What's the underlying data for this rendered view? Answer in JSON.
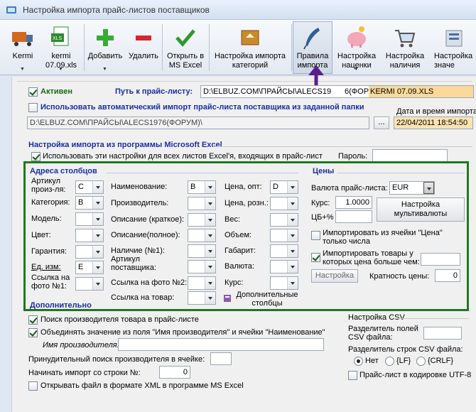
{
  "window": {
    "title": "Настройка импорта прайс-листов поставщиков"
  },
  "toolbar": {
    "kermi": "Kermi",
    "kermi_xls": "kermi\n07.09.xls",
    "add": "Добавить",
    "delete": "Удалить",
    "open_excel": "Открыть в\nMS Excel",
    "category_import": "Настройка импорта\nкатегорий",
    "import_rules": "Правила\nимпорта",
    "markup": "Настройка\nнаценки",
    "availability": "Настройка\nналичия",
    "values": "Настройка\nзначе"
  },
  "general": {
    "active_label": "Активен",
    "path_label": "Путь к прайс-листу:",
    "path_value_a": "D:\\ELBUZ.COM\\ПРАЙСЫ\\ALECS19",
    "path_value_b": "6(ФОРУМ)\\",
    "path_value_c": "KERMI 07.09.XLS",
    "auto_import_label": "Использовать автоматический импорт прайс-листа поставщика из заданной папки",
    "auto_folder_value": "D:\\ELBUZ.COM\\ПРАЙСЫ\\ALECS1976(ФОРУМ)\\",
    "date_label": "Дата и время импорта",
    "date_value": "22/04/2011 18:54:50"
  },
  "excel": {
    "section_label": "Настройка импорта из программы Microsoft Excel",
    "use_all_sheets": "Использовать эти настройки для всех листов Excel'я, входящих в прайс-лист",
    "password_label": "Пароль:",
    "password_value": ""
  },
  "columns": {
    "title": "Адреса столбцов",
    "article_label": "Артикул произ-ля:",
    "article_value": "C",
    "category_label": "Категория:",
    "category_value": "B",
    "model_label": "Модель:",
    "color_label": "Цвет:",
    "warranty_label": "Гарантия:",
    "unit_label": "Ед. изм:",
    "unit_value": "E",
    "photo_link_label": "Ссылка на фото №1:",
    "name_label": "Наименование:",
    "name_value": "B",
    "maker_label": "Производитель:",
    "desc_short_label": "Описание (краткое):",
    "desc_full_label": "Описание(полное):",
    "presence_label": "Наличие (№1):",
    "supplier_article_label": "Артикул поставщика:",
    "photo2_label": "Ссылка на фото №2:",
    "product_link_label": "Ссылка на товар:",
    "price_opt_label": "Цена, опт:",
    "price_opt_value": "D",
    "price_retail_label": "Цена, розн.:",
    "weight_label": "Вес:",
    "volume_label": "Объем:",
    "size_label": "Габарит:",
    "currency_label": "Валюта:",
    "rate_label": "Курс:",
    "extra_columns": "Дополнительные столбцы"
  },
  "prices": {
    "title": "Цены",
    "currency_label": "Валюта прайс-листа:",
    "currency_value": "EUR",
    "rate_label": "Курс:",
    "rate_value": "1.0000",
    "cb_label": "ЦБ+%",
    "cb_value": "",
    "multicurrency_button": "Настройка\nмультивалюты",
    "numbers_only": "Импортировать из ячейки \"Цена\" только числа",
    "price_greater": "Импортировать товары у которых цена больше чем:",
    "price_greater_value": "",
    "settings_button": "Настройка",
    "multiplicity_label": "Кратность цены:",
    "multiplicity_value": "0"
  },
  "additional": {
    "title": "Дополнительно",
    "search_maker": "Поиск производителя товара в прайс-листе",
    "merge_names": "Объединять значение из поля \"Имя производителя\" и ячейки \"Наименование\"",
    "maker_name_label": "Имя производителя:",
    "maker_name_value": "",
    "forced_search_label": "Принудительный поиск производителя в ячейке:",
    "forced_search_value": "",
    "start_row_label": "Начинать импорт со строки №:",
    "start_row_value": "0",
    "open_xml": "Открывать файл в формате XML в программе MS Excel"
  },
  "csv": {
    "title": "Настройка CSV",
    "field_sep_label": "Разделитель полей CSV файла:",
    "field_sep_value": "",
    "row_sep_label": "Разделитель строк CSV файла:",
    "opt_none": "Нет",
    "opt_lf": "{LF}",
    "opt_crlf": "{CRLF}",
    "utf8": "Прайс-лист в кодировке UTF-8"
  }
}
